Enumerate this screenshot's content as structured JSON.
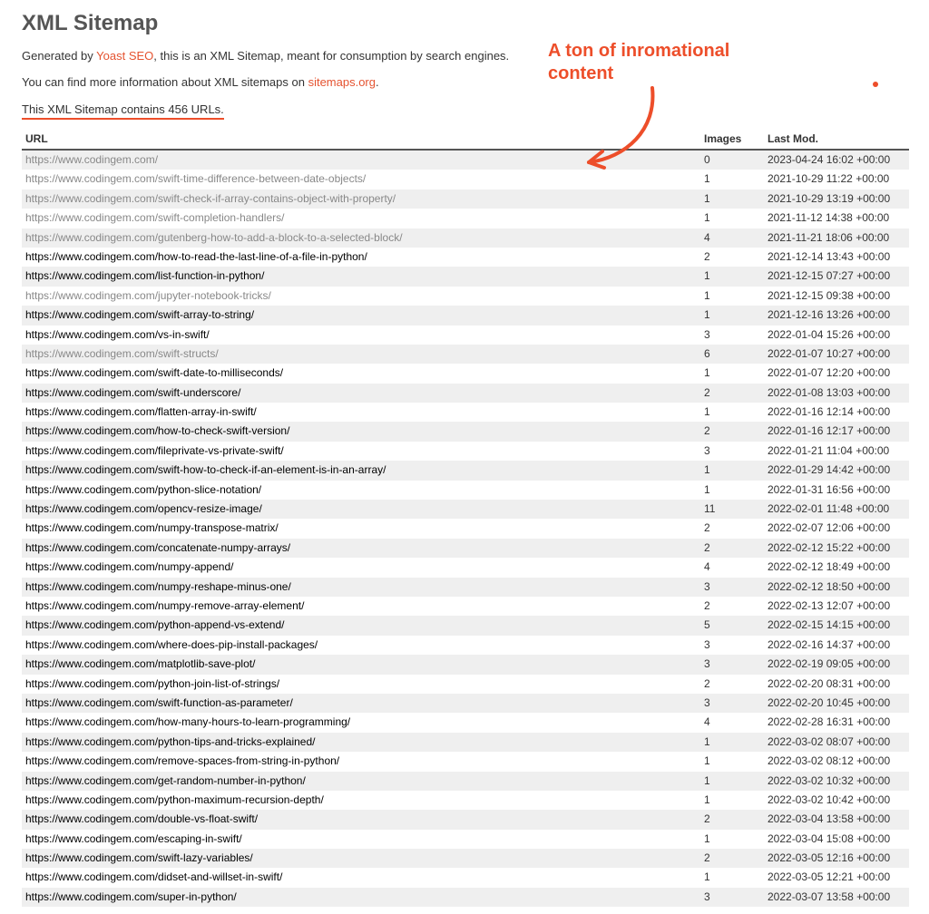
{
  "title": "XML Sitemap",
  "intro1_pre": "Generated by ",
  "intro1_link": "Yoast SEO",
  "intro1_post": ", this is an XML Sitemap, meant for consumption by search engines.",
  "intro2_pre": "You can find more information about XML sitemaps on ",
  "intro2_link": "sitemaps.org",
  "intro2_post": ".",
  "count_line": "This XML Sitemap contains 456 URLs.",
  "headers": {
    "url": "URL",
    "images": "Images",
    "lastmod": "Last Mod."
  },
  "annotation": {
    "line1": "A ton of inromational",
    "line2": "content"
  },
  "rows": [
    {
      "url": "https://www.codingem.com/",
      "images": "0",
      "lastmod": "2023-04-24 16:02 +00:00",
      "visited": true
    },
    {
      "url": "https://www.codingem.com/swift-time-difference-between-date-objects/",
      "images": "1",
      "lastmod": "2021-10-29 11:22 +00:00",
      "visited": true
    },
    {
      "url": "https://www.codingem.com/swift-check-if-array-contains-object-with-property/",
      "images": "1",
      "lastmod": "2021-10-29 13:19 +00:00",
      "visited": true
    },
    {
      "url": "https://www.codingem.com/swift-completion-handlers/",
      "images": "1",
      "lastmod": "2021-11-12 14:38 +00:00",
      "visited": true
    },
    {
      "url": "https://www.codingem.com/gutenberg-how-to-add-a-block-to-a-selected-block/",
      "images": "4",
      "lastmod": "2021-11-21 18:06 +00:00",
      "visited": true
    },
    {
      "url": "https://www.codingem.com/how-to-read-the-last-line-of-a-file-in-python/",
      "images": "2",
      "lastmod": "2021-12-14 13:43 +00:00",
      "visited": false
    },
    {
      "url": "https://www.codingem.com/list-function-in-python/",
      "images": "1",
      "lastmod": "2021-12-15 07:27 +00:00",
      "visited": false
    },
    {
      "url": "https://www.codingem.com/jupyter-notebook-tricks/",
      "images": "1",
      "lastmod": "2021-12-15 09:38 +00:00",
      "visited": true
    },
    {
      "url": "https://www.codingem.com/swift-array-to-string/",
      "images": "1",
      "lastmod": "2021-12-16 13:26 +00:00",
      "visited": false
    },
    {
      "url": "https://www.codingem.com/vs-in-swift/",
      "images": "3",
      "lastmod": "2022-01-04 15:26 +00:00",
      "visited": false
    },
    {
      "url": "https://www.codingem.com/swift-structs/",
      "images": "6",
      "lastmod": "2022-01-07 10:27 +00:00",
      "visited": true
    },
    {
      "url": "https://www.codingem.com/swift-date-to-milliseconds/",
      "images": "1",
      "lastmod": "2022-01-07 12:20 +00:00",
      "visited": false
    },
    {
      "url": "https://www.codingem.com/swift-underscore/",
      "images": "2",
      "lastmod": "2022-01-08 13:03 +00:00",
      "visited": false
    },
    {
      "url": "https://www.codingem.com/flatten-array-in-swift/",
      "images": "1",
      "lastmod": "2022-01-16 12:14 +00:00",
      "visited": false
    },
    {
      "url": "https://www.codingem.com/how-to-check-swift-version/",
      "images": "2",
      "lastmod": "2022-01-16 12:17 +00:00",
      "visited": false
    },
    {
      "url": "https://www.codingem.com/fileprivate-vs-private-swift/",
      "images": "3",
      "lastmod": "2022-01-21 11:04 +00:00",
      "visited": false
    },
    {
      "url": "https://www.codingem.com/swift-how-to-check-if-an-element-is-in-an-array/",
      "images": "1",
      "lastmod": "2022-01-29 14:42 +00:00",
      "visited": false
    },
    {
      "url": "https://www.codingem.com/python-slice-notation/",
      "images": "1",
      "lastmod": "2022-01-31 16:56 +00:00",
      "visited": false
    },
    {
      "url": "https://www.codingem.com/opencv-resize-image/",
      "images": "11",
      "lastmod": "2022-02-01 11:48 +00:00",
      "visited": false
    },
    {
      "url": "https://www.codingem.com/numpy-transpose-matrix/",
      "images": "2",
      "lastmod": "2022-02-07 12:06 +00:00",
      "visited": false
    },
    {
      "url": "https://www.codingem.com/concatenate-numpy-arrays/",
      "images": "2",
      "lastmod": "2022-02-12 15:22 +00:00",
      "visited": false
    },
    {
      "url": "https://www.codingem.com/numpy-append/",
      "images": "4",
      "lastmod": "2022-02-12 18:49 +00:00",
      "visited": false
    },
    {
      "url": "https://www.codingem.com/numpy-reshape-minus-one/",
      "images": "3",
      "lastmod": "2022-02-12 18:50 +00:00",
      "visited": false
    },
    {
      "url": "https://www.codingem.com/numpy-remove-array-element/",
      "images": "2",
      "lastmod": "2022-02-13 12:07 +00:00",
      "visited": false
    },
    {
      "url": "https://www.codingem.com/python-append-vs-extend/",
      "images": "5",
      "lastmod": "2022-02-15 14:15 +00:00",
      "visited": false
    },
    {
      "url": "https://www.codingem.com/where-does-pip-install-packages/",
      "images": "3",
      "lastmod": "2022-02-16 14:37 +00:00",
      "visited": false
    },
    {
      "url": "https://www.codingem.com/matplotlib-save-plot/",
      "images": "3",
      "lastmod": "2022-02-19 09:05 +00:00",
      "visited": false
    },
    {
      "url": "https://www.codingem.com/python-join-list-of-strings/",
      "images": "2",
      "lastmod": "2022-02-20 08:31 +00:00",
      "visited": false
    },
    {
      "url": "https://www.codingem.com/swift-function-as-parameter/",
      "images": "3",
      "lastmod": "2022-02-20 10:45 +00:00",
      "visited": false
    },
    {
      "url": "https://www.codingem.com/how-many-hours-to-learn-programming/",
      "images": "4",
      "lastmod": "2022-02-28 16:31 +00:00",
      "visited": false
    },
    {
      "url": "https://www.codingem.com/python-tips-and-tricks-explained/",
      "images": "1",
      "lastmod": "2022-03-02 08:07 +00:00",
      "visited": false
    },
    {
      "url": "https://www.codingem.com/remove-spaces-from-string-in-python/",
      "images": "1",
      "lastmod": "2022-03-02 08:12 +00:00",
      "visited": false
    },
    {
      "url": "https://www.codingem.com/get-random-number-in-python/",
      "images": "1",
      "lastmod": "2022-03-02 10:32 +00:00",
      "visited": false
    },
    {
      "url": "https://www.codingem.com/python-maximum-recursion-depth/",
      "images": "1",
      "lastmod": "2022-03-02 10:42 +00:00",
      "visited": false
    },
    {
      "url": "https://www.codingem.com/double-vs-float-swift/",
      "images": "2",
      "lastmod": "2022-03-04 13:58 +00:00",
      "visited": false
    },
    {
      "url": "https://www.codingem.com/escaping-in-swift/",
      "images": "1",
      "lastmod": "2022-03-04 15:08 +00:00",
      "visited": false
    },
    {
      "url": "https://www.codingem.com/swift-lazy-variables/",
      "images": "2",
      "lastmod": "2022-03-05 12:16 +00:00",
      "visited": false
    },
    {
      "url": "https://www.codingem.com/didset-and-willset-in-swift/",
      "images": "1",
      "lastmod": "2022-03-05 12:21 +00:00",
      "visited": false
    },
    {
      "url": "https://www.codingem.com/super-in-python/",
      "images": "3",
      "lastmod": "2022-03-07 13:58 +00:00",
      "visited": false
    }
  ]
}
